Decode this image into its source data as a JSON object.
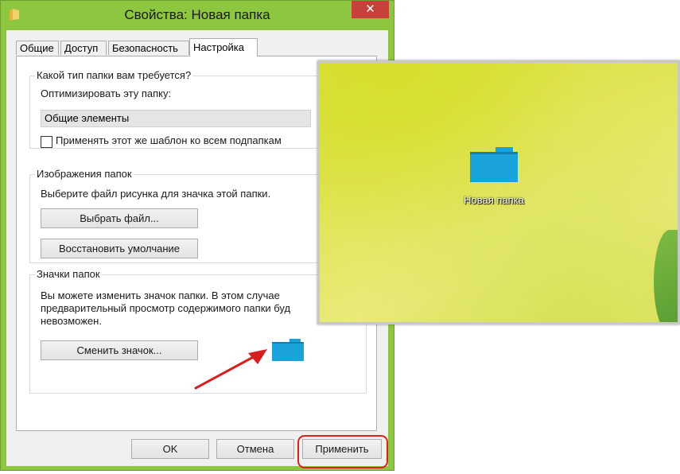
{
  "window": {
    "title": "Свойства: Новая папка",
    "close_glyph": "✕"
  },
  "tabs": [
    {
      "label": "Общие"
    },
    {
      "label": "Доступ"
    },
    {
      "label": "Безопасность"
    },
    {
      "label": "Настройка",
      "active": true
    }
  ],
  "folder_type": {
    "group_title": "Какой тип папки вам требуется?",
    "optimize_label": "Оптимизировать эту папку:",
    "optimize_value": "Общие элементы",
    "apply_subfolders_label": "Применять этот же шаблон ко всем подпапкам",
    "apply_subfolders_checked": false
  },
  "folder_pictures": {
    "group_title": "Изображения папок",
    "description": "Выберите файл рисунка для значка этой папки.",
    "choose_file_button": "Выбрать файл...",
    "restore_default_button": "Восстановить умолчание"
  },
  "folder_icons": {
    "group_title": "Значки папок",
    "description_line1": "Вы можете изменить значок папки. В этом случае",
    "description_line2": "предварительный просмотр содержимого папки буд",
    "description_line3": "невозможен.",
    "change_icon_button": "Сменить значок..."
  },
  "buttons": {
    "ok": "OK",
    "cancel": "Отмена",
    "apply": "Применить"
  },
  "desktop_preview": {
    "folder_label": "Новая папка"
  },
  "colors": {
    "window_frame": "#8dc63f",
    "close_button": "#c7403a",
    "folder_icon": "#1aa3d8",
    "highlight": "#e0201b",
    "wallpaper": "#dfe35a"
  },
  "icons": {
    "title": "folder-icon",
    "changed_folder": "folder-icon",
    "desktop_folder": "folder-icon",
    "annotation": "arrow-icon"
  }
}
